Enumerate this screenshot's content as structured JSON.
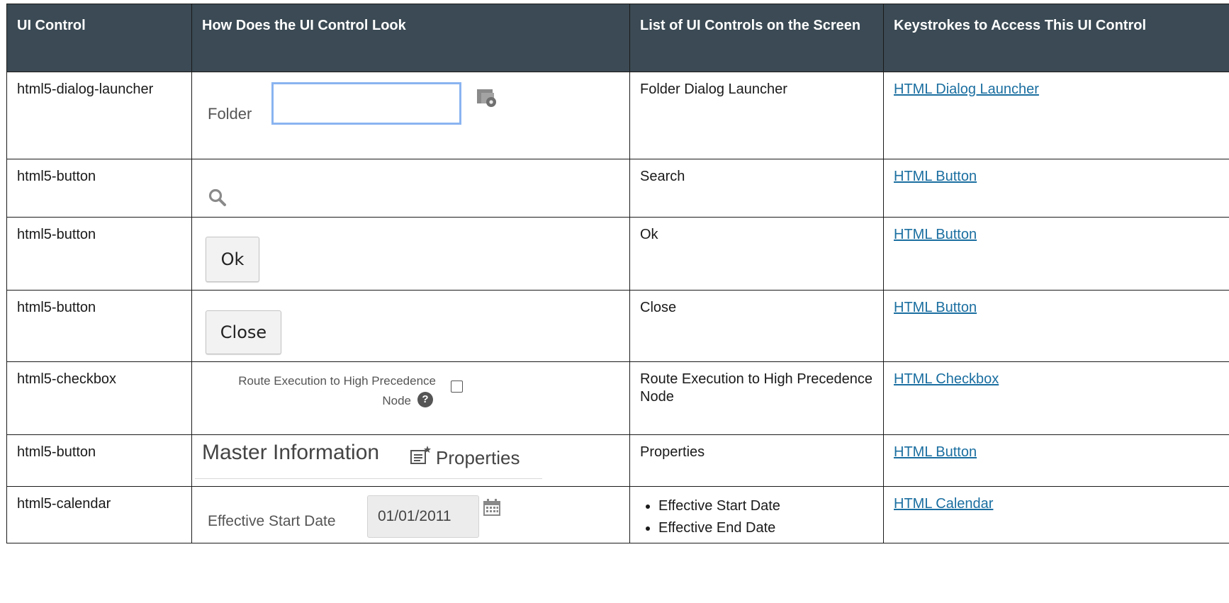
{
  "headers": [
    "UI Control",
    "How Does the UI Control Look",
    "List of UI Controls on the Screen",
    "Keystrokes to Access This UI Control"
  ],
  "rows": [
    {
      "control": "html5-dialog-launcher",
      "list": "Folder Dialog Launcher",
      "link": "HTML Dialog Launcher"
    },
    {
      "control": "html5-button",
      "list": "Search",
      "link": "HTML Button"
    },
    {
      "control": "html5-button",
      "list": "Ok",
      "link": "HTML Button"
    },
    {
      "control": "html5-button",
      "list": "Close",
      "link": "HTML Button"
    },
    {
      "control": "html5-checkbox",
      "list": "Route Execution to High Precedence Node",
      "link": "HTML Checkbox"
    },
    {
      "control": "html5-button",
      "list": "Properties",
      "link": "HTML Button"
    },
    {
      "control": "html5-calendar",
      "list_items": [
        "Effective Start Date",
        "Effective End Date"
      ],
      "link": "HTML Calendar"
    }
  ],
  "samples": {
    "folder_label": "Folder",
    "ok_label": "Ok",
    "close_label": "Close",
    "checkbox_label_line1": "Route Execution to High Precedence",
    "checkbox_label_line2": "Node",
    "help_glyph": "?",
    "master_information": "Master Information",
    "properties": "Properties",
    "calendar_label": "Effective Start Date",
    "calendar_value": "01/01/2011"
  },
  "colors": {
    "header_bg": "#3b4a54",
    "link": "#1a6ea0",
    "input_focus": "#8ab4f0"
  }
}
